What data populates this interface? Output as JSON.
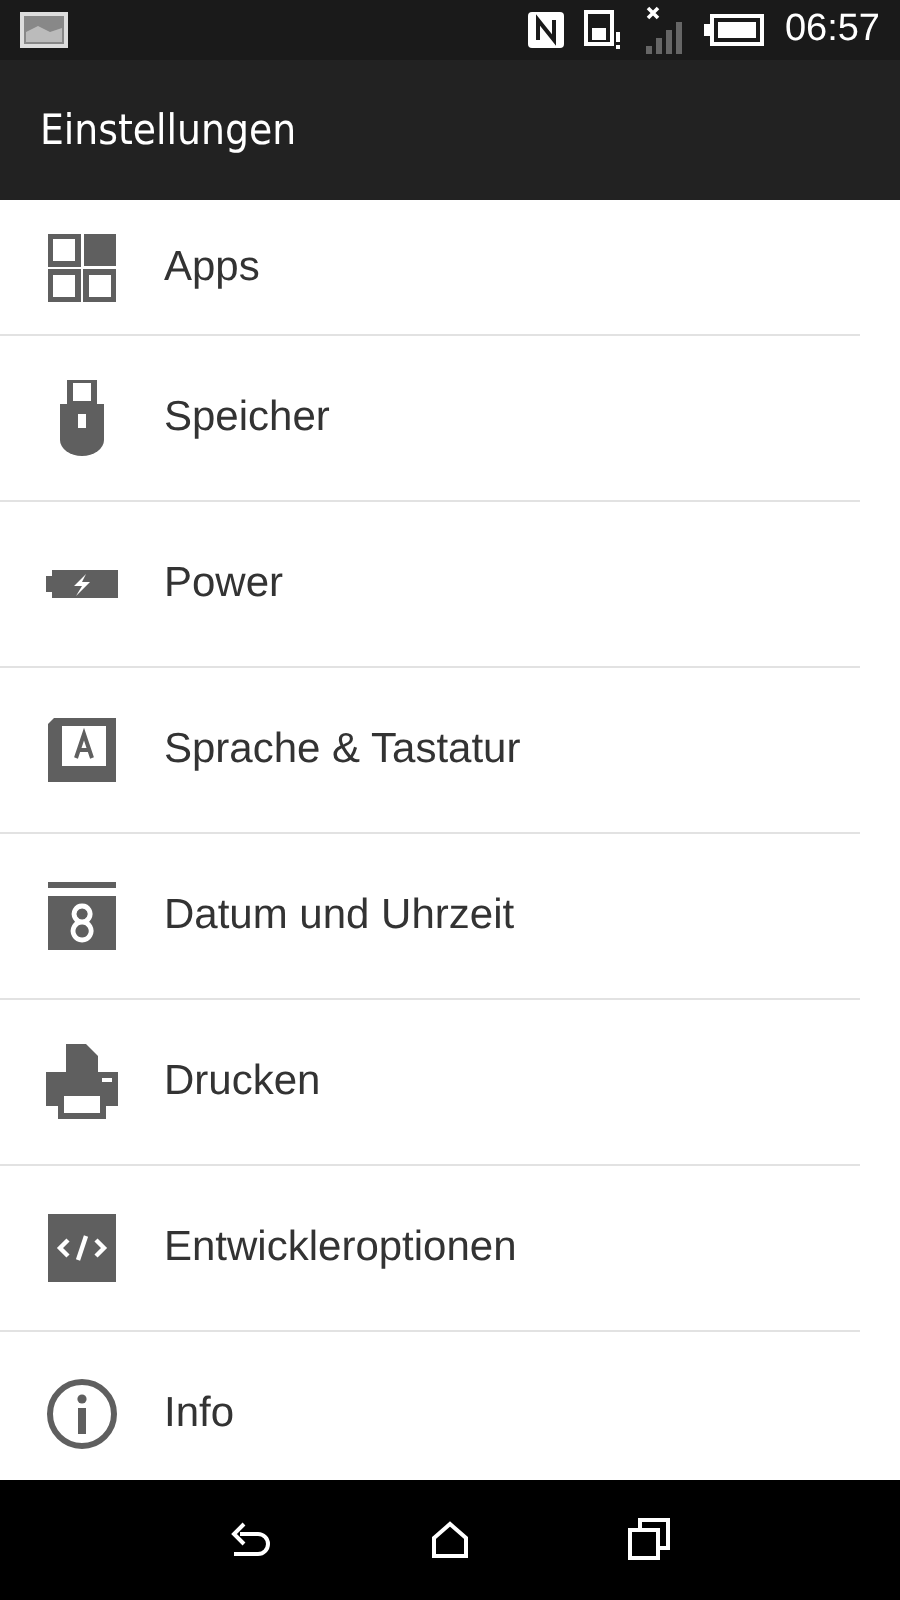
{
  "status_bar": {
    "time": "06:57"
  },
  "app_bar": {
    "title": "Einstellungen"
  },
  "settings": [
    {
      "label": "Apps",
      "kind": "apps"
    },
    {
      "label": "Speicher",
      "kind": "storage"
    },
    {
      "label": "Power",
      "kind": "power"
    },
    {
      "label": "Sprache & Tastatur",
      "kind": "language"
    },
    {
      "label": "Datum und Uhrzeit",
      "kind": "date"
    },
    {
      "label": "Drucken",
      "kind": "print"
    },
    {
      "label": "Entwickleroptionen",
      "kind": "developer"
    },
    {
      "label": "Info",
      "kind": "info"
    }
  ]
}
